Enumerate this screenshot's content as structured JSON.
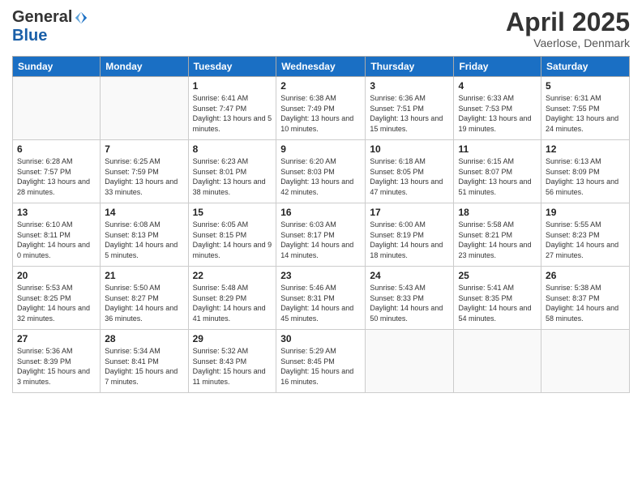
{
  "logo": {
    "general": "General",
    "blue": "Blue"
  },
  "header": {
    "month": "April 2025",
    "location": "Vaerlose, Denmark"
  },
  "weekdays": [
    "Sunday",
    "Monday",
    "Tuesday",
    "Wednesday",
    "Thursday",
    "Friday",
    "Saturday"
  ],
  "weeks": [
    [
      {
        "day": "",
        "info": ""
      },
      {
        "day": "",
        "info": ""
      },
      {
        "day": "1",
        "info": "Sunrise: 6:41 AM\nSunset: 7:47 PM\nDaylight: 13 hours and 5 minutes."
      },
      {
        "day": "2",
        "info": "Sunrise: 6:38 AM\nSunset: 7:49 PM\nDaylight: 13 hours and 10 minutes."
      },
      {
        "day": "3",
        "info": "Sunrise: 6:36 AM\nSunset: 7:51 PM\nDaylight: 13 hours and 15 minutes."
      },
      {
        "day": "4",
        "info": "Sunrise: 6:33 AM\nSunset: 7:53 PM\nDaylight: 13 hours and 19 minutes."
      },
      {
        "day": "5",
        "info": "Sunrise: 6:31 AM\nSunset: 7:55 PM\nDaylight: 13 hours and 24 minutes."
      }
    ],
    [
      {
        "day": "6",
        "info": "Sunrise: 6:28 AM\nSunset: 7:57 PM\nDaylight: 13 hours and 28 minutes."
      },
      {
        "day": "7",
        "info": "Sunrise: 6:25 AM\nSunset: 7:59 PM\nDaylight: 13 hours and 33 minutes."
      },
      {
        "day": "8",
        "info": "Sunrise: 6:23 AM\nSunset: 8:01 PM\nDaylight: 13 hours and 38 minutes."
      },
      {
        "day": "9",
        "info": "Sunrise: 6:20 AM\nSunset: 8:03 PM\nDaylight: 13 hours and 42 minutes."
      },
      {
        "day": "10",
        "info": "Sunrise: 6:18 AM\nSunset: 8:05 PM\nDaylight: 13 hours and 47 minutes."
      },
      {
        "day": "11",
        "info": "Sunrise: 6:15 AM\nSunset: 8:07 PM\nDaylight: 13 hours and 51 minutes."
      },
      {
        "day": "12",
        "info": "Sunrise: 6:13 AM\nSunset: 8:09 PM\nDaylight: 13 hours and 56 minutes."
      }
    ],
    [
      {
        "day": "13",
        "info": "Sunrise: 6:10 AM\nSunset: 8:11 PM\nDaylight: 14 hours and 0 minutes."
      },
      {
        "day": "14",
        "info": "Sunrise: 6:08 AM\nSunset: 8:13 PM\nDaylight: 14 hours and 5 minutes."
      },
      {
        "day": "15",
        "info": "Sunrise: 6:05 AM\nSunset: 8:15 PM\nDaylight: 14 hours and 9 minutes."
      },
      {
        "day": "16",
        "info": "Sunrise: 6:03 AM\nSunset: 8:17 PM\nDaylight: 14 hours and 14 minutes."
      },
      {
        "day": "17",
        "info": "Sunrise: 6:00 AM\nSunset: 8:19 PM\nDaylight: 14 hours and 18 minutes."
      },
      {
        "day": "18",
        "info": "Sunrise: 5:58 AM\nSunset: 8:21 PM\nDaylight: 14 hours and 23 minutes."
      },
      {
        "day": "19",
        "info": "Sunrise: 5:55 AM\nSunset: 8:23 PM\nDaylight: 14 hours and 27 minutes."
      }
    ],
    [
      {
        "day": "20",
        "info": "Sunrise: 5:53 AM\nSunset: 8:25 PM\nDaylight: 14 hours and 32 minutes."
      },
      {
        "day": "21",
        "info": "Sunrise: 5:50 AM\nSunset: 8:27 PM\nDaylight: 14 hours and 36 minutes."
      },
      {
        "day": "22",
        "info": "Sunrise: 5:48 AM\nSunset: 8:29 PM\nDaylight: 14 hours and 41 minutes."
      },
      {
        "day": "23",
        "info": "Sunrise: 5:46 AM\nSunset: 8:31 PM\nDaylight: 14 hours and 45 minutes."
      },
      {
        "day": "24",
        "info": "Sunrise: 5:43 AM\nSunset: 8:33 PM\nDaylight: 14 hours and 50 minutes."
      },
      {
        "day": "25",
        "info": "Sunrise: 5:41 AM\nSunset: 8:35 PM\nDaylight: 14 hours and 54 minutes."
      },
      {
        "day": "26",
        "info": "Sunrise: 5:38 AM\nSunset: 8:37 PM\nDaylight: 14 hours and 58 minutes."
      }
    ],
    [
      {
        "day": "27",
        "info": "Sunrise: 5:36 AM\nSunset: 8:39 PM\nDaylight: 15 hours and 3 minutes."
      },
      {
        "day": "28",
        "info": "Sunrise: 5:34 AM\nSunset: 8:41 PM\nDaylight: 15 hours and 7 minutes."
      },
      {
        "day": "29",
        "info": "Sunrise: 5:32 AM\nSunset: 8:43 PM\nDaylight: 15 hours and 11 minutes."
      },
      {
        "day": "30",
        "info": "Sunrise: 5:29 AM\nSunset: 8:45 PM\nDaylight: 15 hours and 16 minutes."
      },
      {
        "day": "",
        "info": ""
      },
      {
        "day": "",
        "info": ""
      },
      {
        "day": "",
        "info": ""
      }
    ]
  ]
}
